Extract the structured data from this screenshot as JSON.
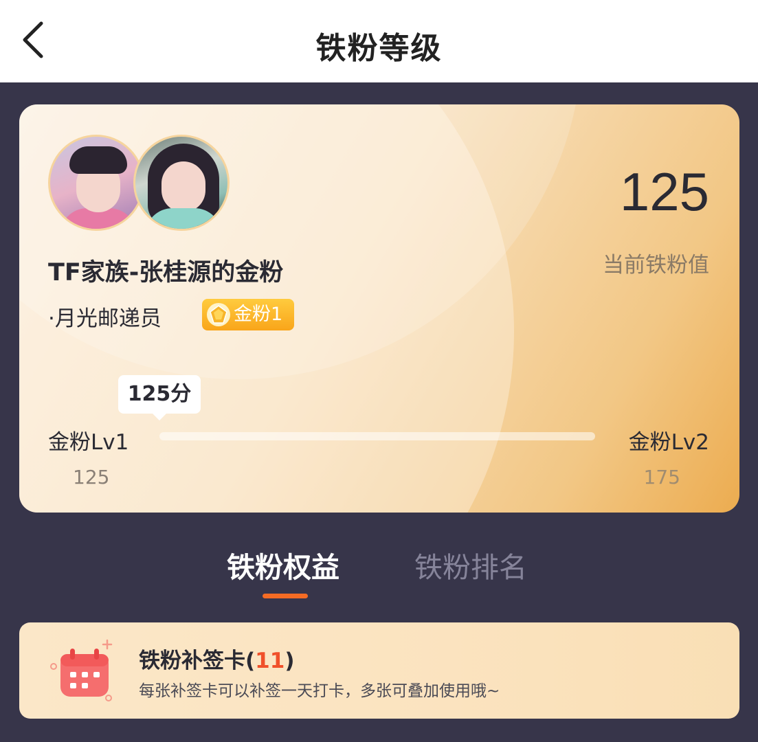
{
  "header": {
    "title": "铁粉等级"
  },
  "card": {
    "fan_name": "TF家族-张桂源的金粉",
    "fan_title": "·月光邮递员",
    "badge_label": "金粉1",
    "score": "125",
    "score_label": "当前铁粉值",
    "tooltip": "125分",
    "level_left": "金粉Lv1",
    "level_right": "金粉Lv2",
    "min_value": "125",
    "max_value": "175",
    "progress": 0
  },
  "tabs": [
    {
      "label": "铁粉权益",
      "active": true
    },
    {
      "label": "铁粉排名",
      "active": false
    }
  ],
  "privilege": {
    "title": "铁粉补签卡",
    "count": "11",
    "description": "每张补签卡可以补签一天打卡，多张可叠加使用哦~"
  },
  "colors": {
    "background": "#37354a",
    "accent": "#f46b24",
    "badge": "#f9a51a",
    "count": "#f0502a"
  },
  "icons": [
    "back-arrow-icon",
    "gold-gem-icon",
    "calendar-icon"
  ]
}
